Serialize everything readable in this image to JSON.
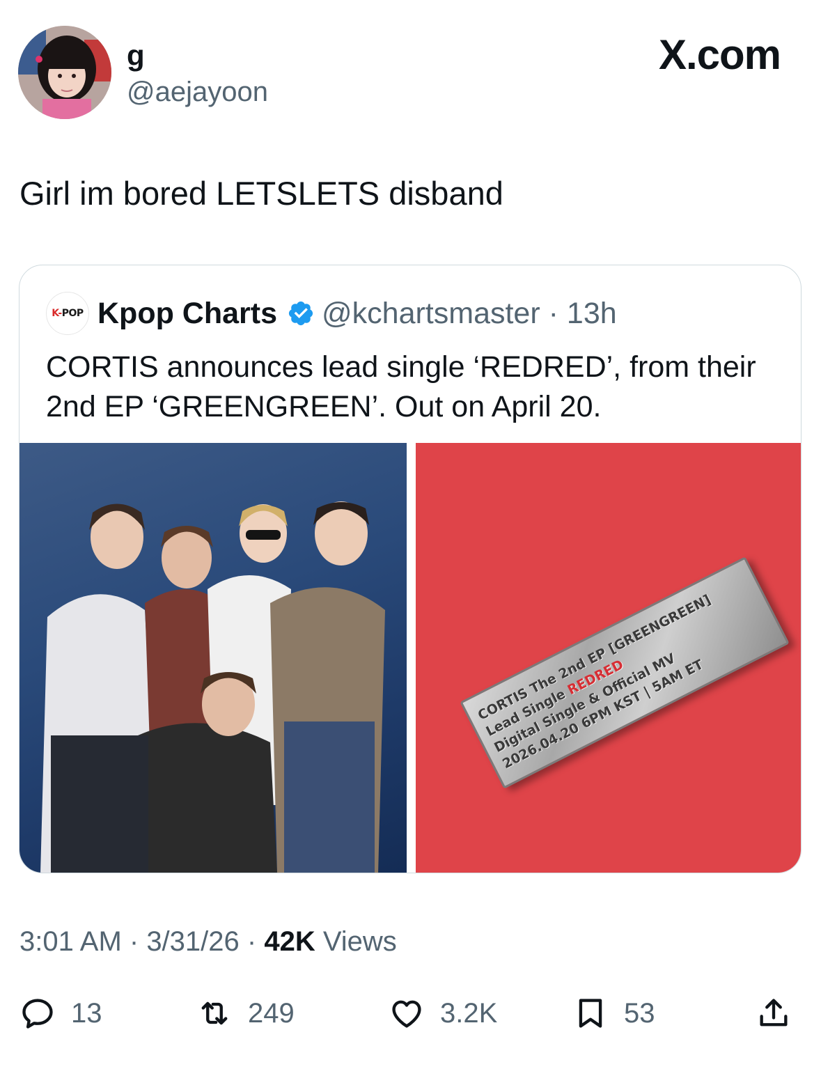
{
  "author": {
    "display_name": "g",
    "handle": "@aejayoon",
    "avatar_icon": "profile-photo"
  },
  "site_mark": "X.com",
  "tweet": {
    "text": "Girl im bored LETSLETS disband"
  },
  "quote": {
    "avatar_label_prefix": "K-",
    "avatar_label_suffix": "POP",
    "name": "Kpop Charts",
    "verified_icon": "verified-badge-icon",
    "handle": "@kchartsmaster",
    "separator": "·",
    "age": "13h",
    "text": "CORTIS announces lead single ‘REDRED’, from their 2nd EP ‘GREENGREEN’. Out on April 20.",
    "media": {
      "left_icon": "group-photo",
      "plate_lines": [
        "CORTIS The 2nd EP [GREENGREEN]",
        "Lead Single ",
        "REDRED",
        "Digital Single & Official MV",
        "2026.04.20 6PM KST | 5AM ET"
      ],
      "background_color": "#df4449"
    }
  },
  "meta": {
    "time": "3:01 AM",
    "sep1": " · ",
    "date": "3/31/26",
    "sep2": " · ",
    "views_count": "42K",
    "views_label": " Views"
  },
  "actions": {
    "replies": "13",
    "reposts": "249",
    "likes": "3.2K",
    "bookmarks": "53"
  },
  "colors": {
    "text": "#0f1419",
    "secondary": "#536471",
    "verified": "#1d9bf0",
    "border": "#cfd9de"
  }
}
